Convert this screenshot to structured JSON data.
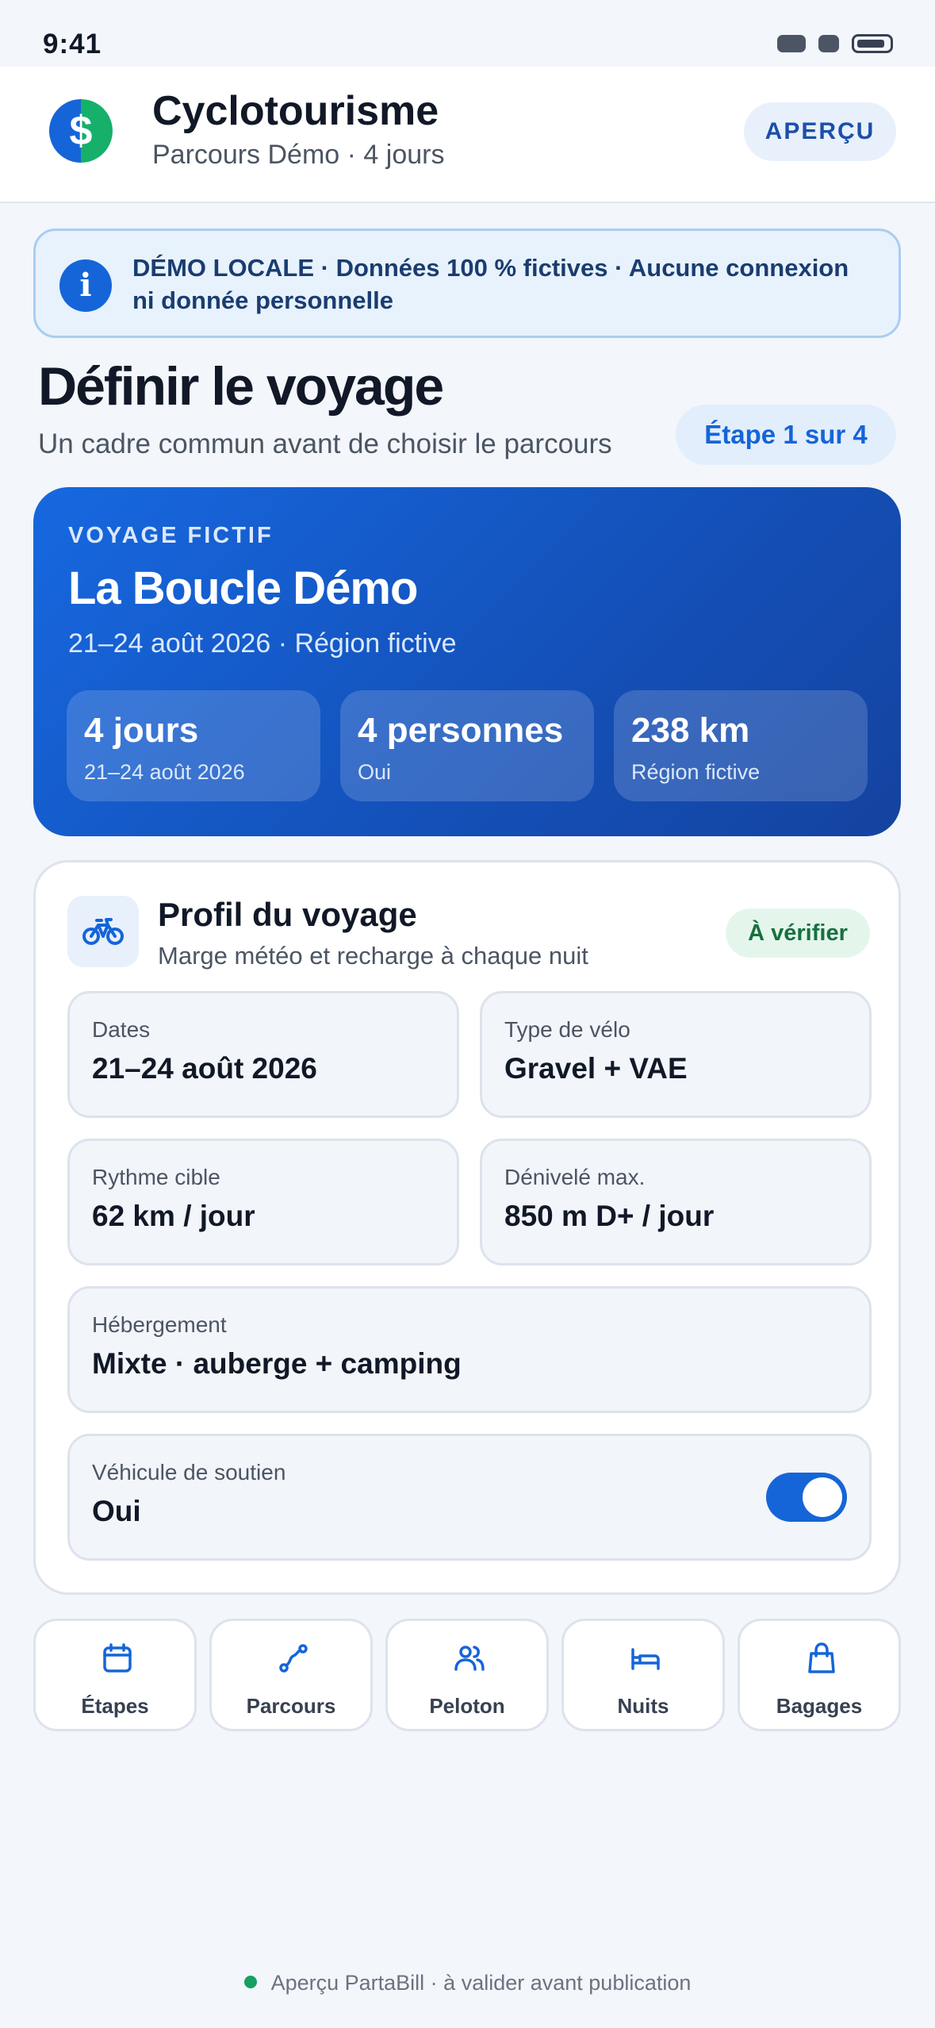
{
  "status_bar": {
    "time": "9:41"
  },
  "header": {
    "logo_symbol": "$",
    "title": "Cyclotourisme",
    "subtitle": "Parcours Démo · 4 jours",
    "preview_label": "APERÇU"
  },
  "banner": {
    "icon": "info-icon",
    "text": "DÉMO LOCALE · Données 100 % fictives · Aucune connexion ni donnée personnelle"
  },
  "page": {
    "title": "Définir le voyage",
    "subtitle": "Un cadre commun avant de choisir le parcours",
    "step_label": "Étape 1 sur 4"
  },
  "hero": {
    "eyebrow": "VOYAGE FICTIF",
    "title": "La Boucle Démo",
    "subtitle": "21–24 août 2026 · Région fictive",
    "stats": [
      {
        "value": "4 jours",
        "label": "21–24 août 2026"
      },
      {
        "value": "4 personnes",
        "label": "Oui"
      },
      {
        "value": "238 km",
        "label": "Région fictive"
      }
    ]
  },
  "profile": {
    "icon": "bicycle-icon",
    "title": "Profil du voyage",
    "subtitle": "Marge météo et recharge à chaque nuit",
    "badge": "À vérifier",
    "fields": {
      "dates": {
        "label": "Dates",
        "value": "21–24 août 2026"
      },
      "bike": {
        "label": "Type de vélo",
        "value": "Gravel + VAE"
      },
      "pace": {
        "label": "Rythme cible",
        "value": "62 km / jour"
      },
      "elevation": {
        "label": "Dénivelé max.",
        "value": "850 m D+ / jour"
      },
      "lodging": {
        "label": "Hébergement",
        "value": "Mixte · auberge + camping"
      },
      "support": {
        "label": "Véhicule de soutien",
        "value": "Oui",
        "toggle_on": true
      }
    }
  },
  "tabs": [
    {
      "label": "Étapes",
      "icon": "calendar-icon"
    },
    {
      "label": "Parcours",
      "icon": "route-icon"
    },
    {
      "label": "Peloton",
      "icon": "people-icon"
    },
    {
      "label": "Nuits",
      "icon": "bed-icon"
    },
    {
      "label": "Bagages",
      "icon": "bag-icon"
    }
  ],
  "footer": {
    "text": "Aperçu PartaBill · à valider avant publication"
  },
  "colors": {
    "accent": "#1565d8",
    "hero_start": "#1668e0",
    "hero_end": "#1443a0",
    "success": "#17703f",
    "background": "#f3f6fb"
  }
}
